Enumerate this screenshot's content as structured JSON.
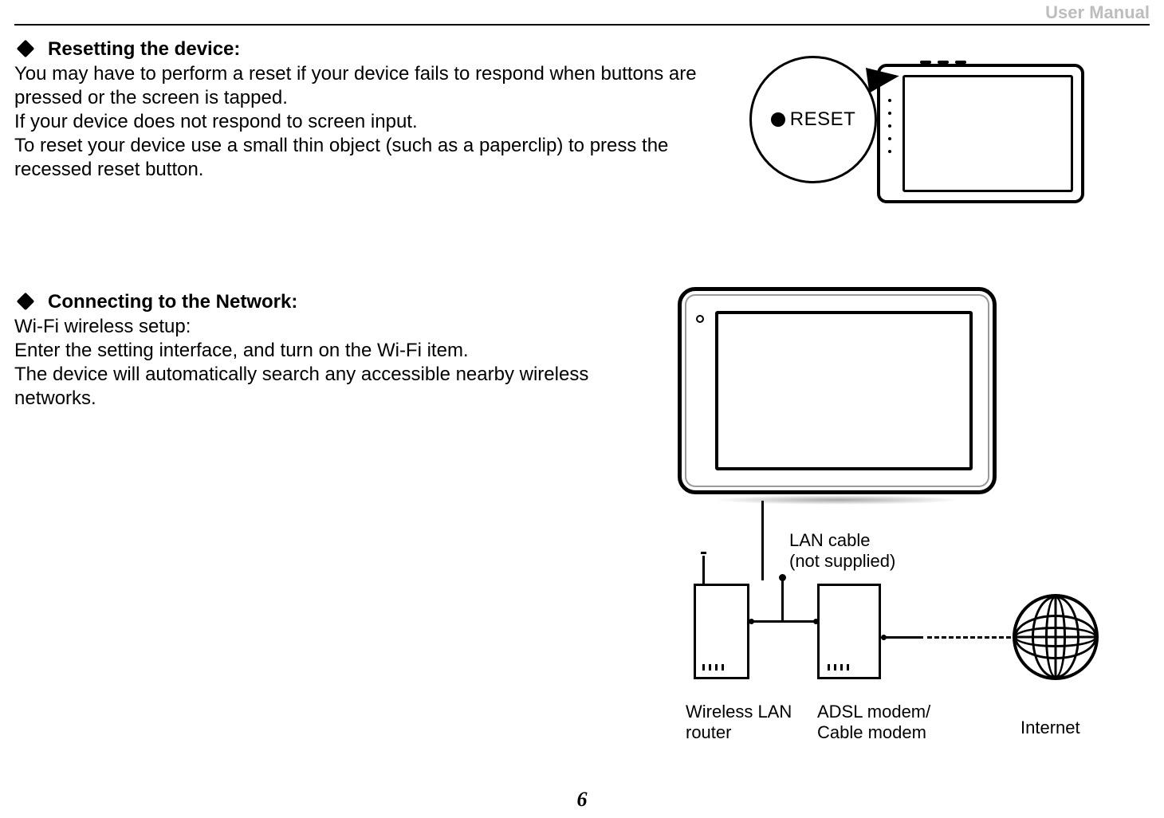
{
  "header": {
    "title": "User Manual"
  },
  "section_reset": {
    "heading": "Resetting the device:",
    "p1": "You may have to perform a reset if your device fails to respond when buttons are pressed or the screen is tapped.",
    "p2": "If your device does not respond to screen input.",
    "p3": "To reset your device use a small thin object (such as a paperclip) to press the recessed reset button.",
    "callout_label": "RESET"
  },
  "section_network": {
    "heading": "Connecting to the Network:",
    "p1": "Wi-Fi wireless setup:",
    "p2": "Enter the setting interface, and turn on the Wi-Fi item.",
    "p3": "The device will automatically search any accessible nearby wireless networks.",
    "lan_label_line1": "LAN cable",
    "lan_label_line2": "(not supplied)",
    "caption_router_line1": "Wireless LAN",
    "caption_router_line2": "router",
    "caption_modem_line1": "ADSL modem/",
    "caption_modem_line2": "Cable modem",
    "caption_internet": "Internet"
  },
  "page_number": "6"
}
